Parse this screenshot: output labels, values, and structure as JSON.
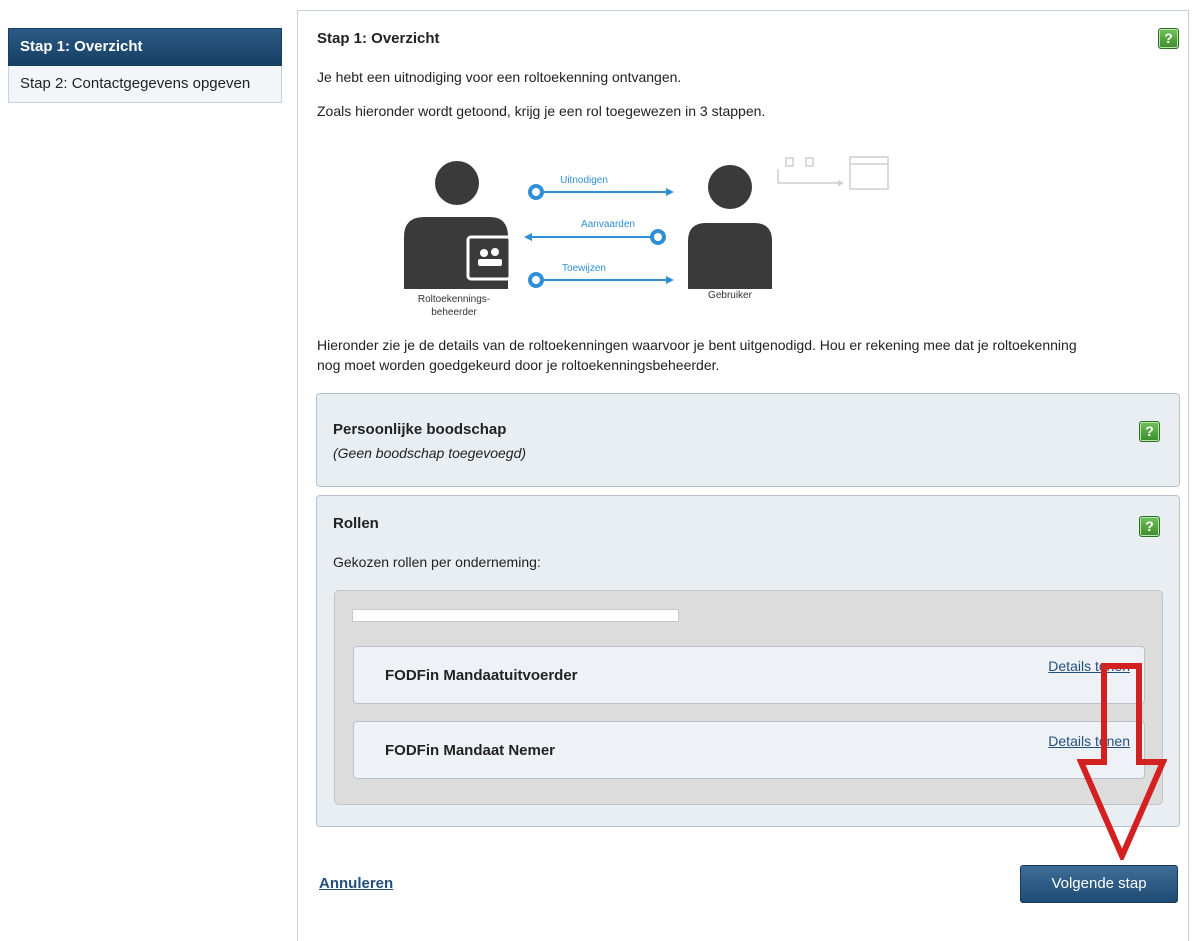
{
  "sidebar": {
    "items": [
      {
        "label": "Stap 1: Overzicht",
        "active": true
      },
      {
        "label": "Stap 2: Contactgegevens opgeven",
        "active": false
      }
    ]
  },
  "main": {
    "title": "Stap 1: Overzicht",
    "intro": "Je hebt een uitnodiging voor een roltoekenning ontvangen.",
    "steps_text": "Zoals hieronder wordt getoond, krijg je een rol toegewezen in 3 stappen.",
    "details_line1": "Hieronder zie je de details van de roltoekenningen waarvoor je bent uitgenodigd. Hou er rekening mee dat je roltoekenning",
    "details_line2": "nog moet worden goedgekeurd door je roltoekenningsbeheerder."
  },
  "diagram": {
    "left_label_1": "Roltoekennings-",
    "left_label_2": "beheerder",
    "right_label": "Gebruiker",
    "step1": "Uitnodigen",
    "step2": "Aanvaarden",
    "step3": "Toewijzen"
  },
  "message_panel": {
    "title": "Persoonlijke boodschap",
    "text": "(Geen boodschap toegevoegd)"
  },
  "roles_panel": {
    "title": "Rollen",
    "subtitle": "Gekozen rollen per onderneming:",
    "roles": [
      {
        "name": "FODFin Mandaatuitvoerder",
        "link": "Details tonen"
      },
      {
        "name": "FODFin Mandaat Nemer",
        "link": "Details tonen"
      }
    ]
  },
  "footer": {
    "cancel": "Annuleren",
    "next": "Volgende stap"
  },
  "help_icon_label": "?",
  "colors": {
    "accent": "#1f4b74",
    "help_green": "#4aa536",
    "annotation_arrow": "#d32020",
    "diagram_blue": "#2f8fd6"
  }
}
